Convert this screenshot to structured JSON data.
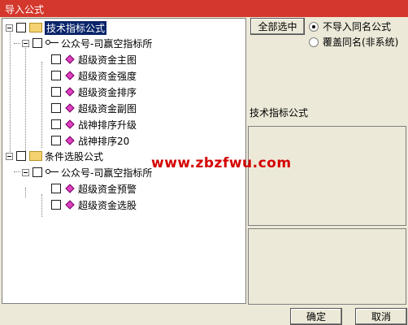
{
  "window": {
    "title": "导入公式"
  },
  "tree": {
    "nodes": [
      {
        "label": "技术指标公式"
      },
      {
        "label": "公众号-司赢空指标所"
      },
      {
        "label": "超级资金主图"
      },
      {
        "label": "超级资金强度"
      },
      {
        "label": "超级资金排序"
      },
      {
        "label": "超级资金副图"
      },
      {
        "label": "战神排序升级"
      },
      {
        "label": "战神排序20"
      },
      {
        "label": "条件选股公式"
      },
      {
        "label": "公众号-司赢空指标所"
      },
      {
        "label": "超级资金预警"
      },
      {
        "label": "超级资金选股"
      }
    ]
  },
  "right": {
    "select_all_label": "全部选中",
    "radio_no_import": "不导入同名公式",
    "radio_overwrite": "覆盖同名(非系统)",
    "info_label": "技术指标公式"
  },
  "footer": {
    "ok_label": "确定",
    "cancel_label": "取消"
  },
  "watermark": "www.zbzfwu.com",
  "colors": {
    "titlebar": "#d4372c",
    "selection": "#0a246a",
    "watermark": "#d40000"
  }
}
